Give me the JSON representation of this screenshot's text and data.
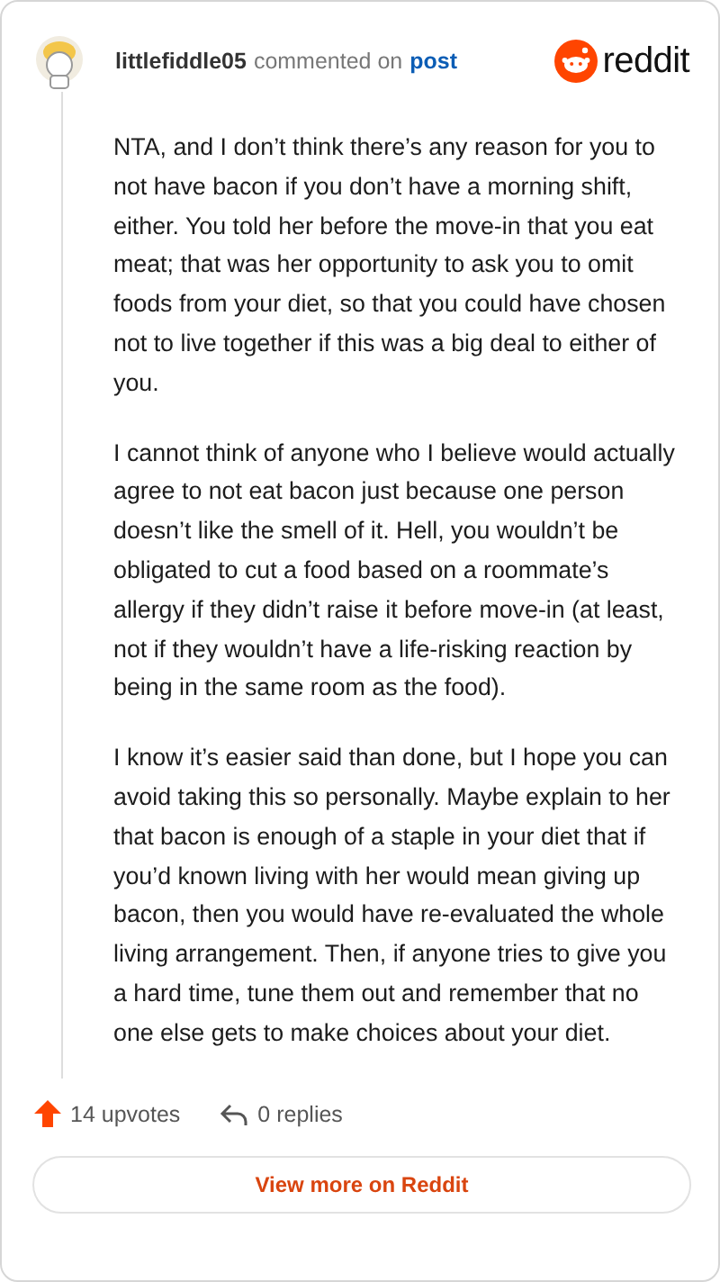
{
  "header": {
    "username": "littlefiddle05",
    "action": "commented on",
    "link": "post",
    "brand": "reddit"
  },
  "paragraphs": [
    "NTA, and I don’t think there’s any reason for you to not have bacon if you don’t have a morning shift, either. You told her before the move-in that you eat meat; that was her opportunity to ask you to omit foods from your diet, so that you could have chosen not to live together if this was a big deal to either of you.",
    "I cannot think of anyone who I believe would actually agree to not eat bacon just because one person doesn’t like the smell of it. Hell, you wouldn’t be obligated to cut a food based on a roommate’s allergy if they didn’t raise it before move-in (at least, not if they wouldn’t have a life-risking reaction by being in the same room as the food).",
    "I know it’s easier said than done, but I hope you can avoid taking this so personally. Maybe explain to her that bacon is enough of a staple in your diet that if you’d known living with her would mean giving up bacon, then you would have re-evaluated the whole living arrangement. Then, if anyone tries to give you a hard time, tune them out and remember that no one else gets to make choices about your diet."
  ],
  "footer": {
    "upvotes": "14 upvotes",
    "replies": "0 replies",
    "button": "View more on Reddit"
  }
}
